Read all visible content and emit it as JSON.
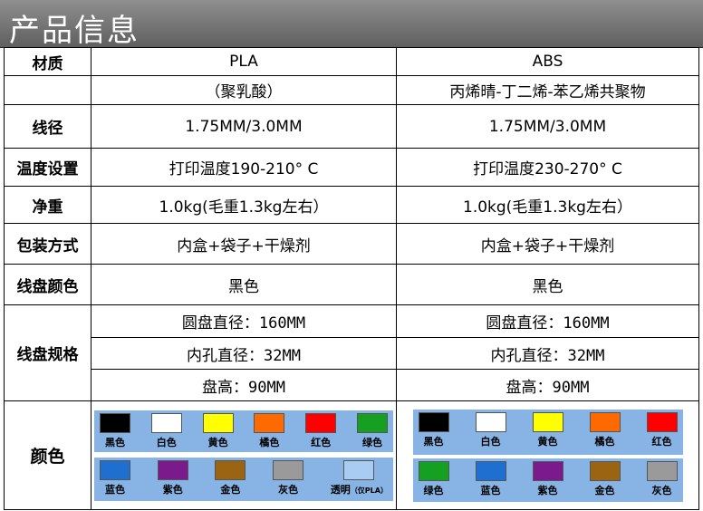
{
  "title": "产品信息",
  "rows": {
    "material": {
      "label": "材质",
      "pla": "PLA",
      "abs": "ABS"
    },
    "material_full": {
      "pla": "（聚乳酸）",
      "abs": "丙烯晴-丁二烯-苯乙烯共聚物"
    },
    "diameter": {
      "label": "线径",
      "pla": "1.75MM/3.0MM",
      "abs": "1.75MM/3.0MM"
    },
    "temperature": {
      "label": "温度设置",
      "pla": "打印温度190-210° C",
      "abs": "打印温度230-270° C"
    },
    "net_weight": {
      "label": "净重",
      "pla": "1.0kg(毛重1.3kg左右）",
      "abs": "1.0kg(毛重1.3kg左右）"
    },
    "packaging": {
      "label": "包装方式",
      "pla": "内盒+袋子+干燥剂",
      "abs": "内盒+袋子+干燥剂"
    },
    "spool_color": {
      "label": "线盘颜色",
      "pla": "黑色",
      "abs": "黑色"
    },
    "spool_spec": {
      "label": "线盘规格",
      "diameter": "圆盘直径：160MM",
      "hole": "内孔直径：32MM",
      "height": "盘高：90MM"
    },
    "colors": {
      "label": "颜色"
    }
  },
  "swatches": {
    "pla_row1": [
      {
        "name": "黑色",
        "hex": "#000000"
      },
      {
        "name": "白色",
        "hex": "#ffffff"
      },
      {
        "name": "黄色",
        "hex": "#ffff00"
      },
      {
        "name": "橘色",
        "hex": "#ff6a00"
      },
      {
        "name": "红色",
        "hex": "#ff0000"
      },
      {
        "name": "绿色",
        "hex": "#16a021"
      }
    ],
    "pla_row2": [
      {
        "name": "蓝色",
        "hex": "#1f6fd0"
      },
      {
        "name": "紫色",
        "hex": "#7a1a8c"
      },
      {
        "name": "金色",
        "hex": "#9a6412"
      },
      {
        "name": "灰色",
        "hex": "#9a9a9a"
      },
      {
        "name": "透明",
        "note": "（仅PLA）",
        "hex": "#a9cdf2"
      }
    ],
    "abs_row1": [
      {
        "name": "黑色",
        "hex": "#000000"
      },
      {
        "name": "白色",
        "hex": "#ffffff"
      },
      {
        "name": "黄色",
        "hex": "#ffff00"
      },
      {
        "name": "橘色",
        "hex": "#ff6a00"
      },
      {
        "name": "红色",
        "hex": "#ff0000"
      }
    ],
    "abs_row2": [
      {
        "name": "绿色",
        "hex": "#16a021"
      },
      {
        "name": "蓝色",
        "hex": "#1f6fd0"
      },
      {
        "name": "紫色",
        "hex": "#7a1a8c"
      },
      {
        "name": "金色",
        "hex": "#9a6412"
      },
      {
        "name": "灰色",
        "hex": "#9a9a9a"
      }
    ]
  }
}
